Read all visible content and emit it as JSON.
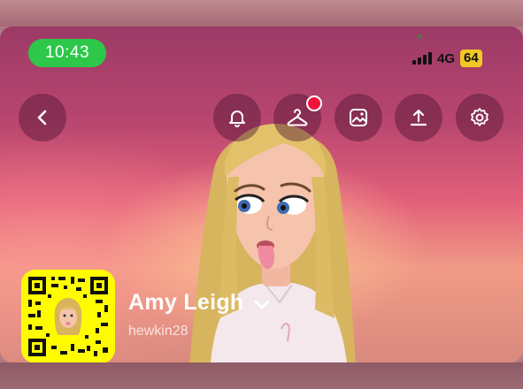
{
  "status_bar": {
    "time": "10:43",
    "network": "4G",
    "battery": "64",
    "signal_bars": 4
  },
  "toolbar": {
    "back_icon": "chevron-left-icon",
    "notifications_icon": "bell-icon",
    "notifications_badge": true,
    "outfit_icon": "hanger-icon",
    "wallpaper_icon": "image-icon",
    "share_icon": "upload-icon",
    "settings_icon": "gear-icon"
  },
  "profile": {
    "display_name": "Amy Leigh",
    "username": "hewkin28"
  },
  "colors": {
    "time_pill": "#2dc84a",
    "badge": "#f0143c",
    "snapcode": "#fffc00"
  }
}
